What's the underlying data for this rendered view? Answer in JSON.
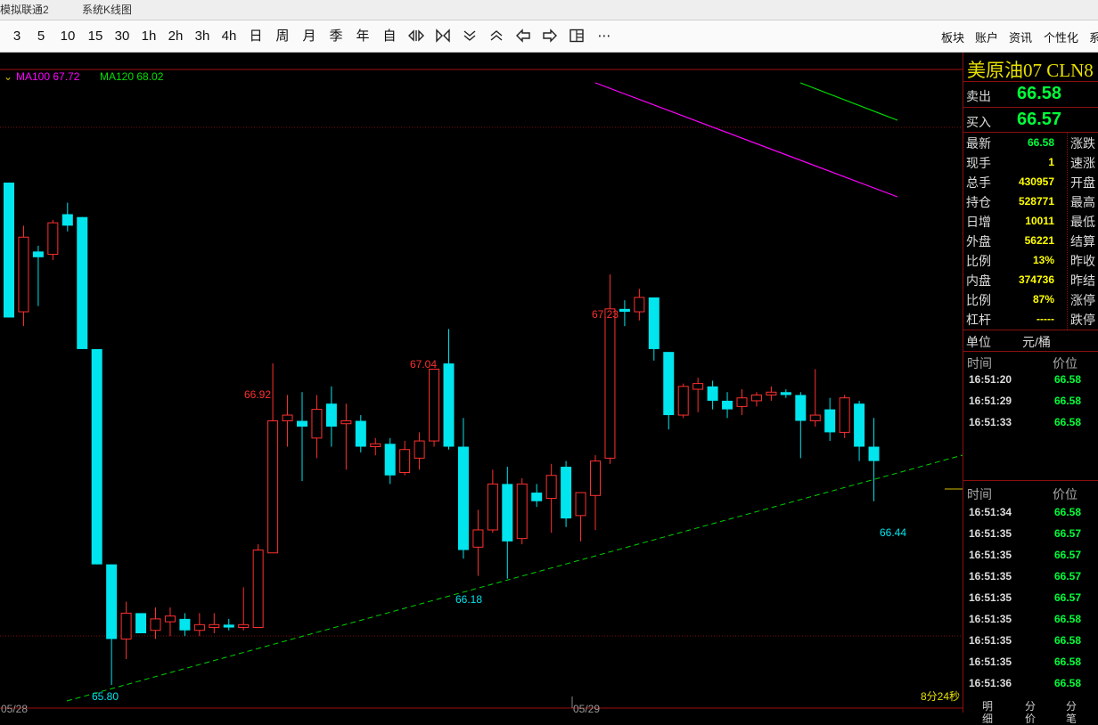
{
  "tabs": [
    "模拟联通2",
    "系统K线图"
  ],
  "toolbar": {
    "periods": [
      "3",
      "5",
      "10",
      "15",
      "30",
      "1h",
      "2h",
      "3h",
      "4h",
      "日",
      "周",
      "月",
      "季",
      "年",
      "自"
    ],
    "icons": [
      "split-view-icon",
      "fit-icon",
      "scroll-down-icon",
      "scroll-up-icon",
      "back-icon",
      "forward-icon",
      "layout-icon",
      "more-icon"
    ],
    "more_label": "⋯",
    "right_menu": [
      "板块",
      "账户",
      "资讯",
      "个性化",
      "系"
    ]
  },
  "chart": {
    "ma_indicator": "",
    "ma100": {
      "label": "MA100",
      "value": "67.72",
      "color": "#ff00ff"
    },
    "ma120": {
      "label": "MA120",
      "value": "68.02",
      "color": "#00e000"
    },
    "price_labels": [
      "67.23",
      "67.04",
      "66.92",
      "66.18",
      "65.80",
      "66.44"
    ],
    "date_labels": [
      "05/28",
      "05/29"
    ],
    "countdown": "8分24秒"
  },
  "chart_data": {
    "type": "candlestick",
    "title": "",
    "colors": {
      "up": "#ff3030",
      "down": "#00e5ee",
      "flat": "#ffffff",
      "trend": "#00d000"
    },
    "highs_lows_labeled": {
      "max": 67.23,
      "max2": 67.04,
      "max3": 66.92,
      "min": 65.8,
      "min2": 66.18,
      "last_low": 66.44
    },
    "candles": [
      {
        "o": 67.55,
        "h": 67.55,
        "l": 67.08,
        "c": 67.08
      },
      {
        "o": 67.1,
        "h": 67.4,
        "l": 67.05,
        "c": 67.36
      },
      {
        "o": 67.31,
        "h": 67.33,
        "l": 67.12,
        "c": 67.29
      },
      {
        "o": 67.3,
        "h": 67.42,
        "l": 67.28,
        "c": 67.41
      },
      {
        "o": 67.44,
        "h": 67.48,
        "l": 67.38,
        "c": 67.4
      },
      {
        "o": 67.43,
        "h": 67.43,
        "l": 66.97,
        "c": 66.97
      },
      {
        "o": 66.97,
        "h": 66.97,
        "l": 66.22,
        "c": 66.22
      },
      {
        "o": 66.22,
        "h": 66.22,
        "l": 65.8,
        "c": 65.96
      },
      {
        "o": 65.96,
        "h": 66.09,
        "l": 65.89,
        "c": 66.05
      },
      {
        "o": 66.05,
        "h": 66.05,
        "l": 65.98,
        "c": 65.98
      },
      {
        "o": 65.99,
        "h": 66.07,
        "l": 65.96,
        "c": 66.03
      },
      {
        "o": 66.02,
        "h": 66.07,
        "l": 65.97,
        "c": 66.04
      },
      {
        "o": 66.03,
        "h": 66.05,
        "l": 65.97,
        "c": 65.99
      },
      {
        "o": 65.99,
        "h": 66.05,
        "l": 65.97,
        "c": 66.01
      },
      {
        "o": 66.0,
        "h": 66.05,
        "l": 65.98,
        "c": 66.01
      },
      {
        "o": 66.01,
        "h": 66.03,
        "l": 65.99,
        "c": 66.0
      },
      {
        "o": 66.0,
        "h": 66.14,
        "l": 65.99,
        "c": 66.01
      },
      {
        "o": 66.0,
        "h": 66.29,
        "l": 66.0,
        "c": 66.27
      },
      {
        "o": 66.26,
        "h": 66.92,
        "l": 66.26,
        "c": 66.72
      },
      {
        "o": 66.72,
        "h": 66.81,
        "l": 66.63,
        "c": 66.74
      },
      {
        "o": 66.72,
        "h": 66.82,
        "l": 66.51,
        "c": 66.7
      },
      {
        "o": 66.66,
        "h": 66.81,
        "l": 66.59,
        "c": 66.76
      },
      {
        "o": 66.78,
        "h": 66.84,
        "l": 66.63,
        "c": 66.7
      },
      {
        "o": 66.71,
        "h": 66.78,
        "l": 66.55,
        "c": 66.72
      },
      {
        "o": 66.72,
        "h": 66.74,
        "l": 66.61,
        "c": 66.63
      },
      {
        "o": 66.63,
        "h": 66.66,
        "l": 66.6,
        "c": 66.64
      },
      {
        "o": 66.64,
        "h": 66.66,
        "l": 66.5,
        "c": 66.53
      },
      {
        "o": 66.54,
        "h": 66.65,
        "l": 66.53,
        "c": 66.62
      },
      {
        "o": 66.59,
        "h": 66.68,
        "l": 66.55,
        "c": 66.65
      },
      {
        "o": 66.65,
        "h": 66.81,
        "l": 66.63,
        "c": 66.9
      },
      {
        "o": 66.92,
        "h": 67.04,
        "l": 66.62,
        "c": 66.63
      },
      {
        "o": 66.63,
        "h": 66.73,
        "l": 66.24,
        "c": 66.27
      },
      {
        "o": 66.28,
        "h": 66.41,
        "l": 66.18,
        "c": 66.34
      },
      {
        "o": 66.34,
        "h": 66.55,
        "l": 66.33,
        "c": 66.5
      },
      {
        "o": 66.5,
        "h": 66.56,
        "l": 66.17,
        "c": 66.3
      },
      {
        "o": 66.31,
        "h": 66.52,
        "l": 66.29,
        "c": 66.5
      },
      {
        "o": 66.47,
        "h": 66.5,
        "l": 66.42,
        "c": 66.44
      },
      {
        "o": 66.45,
        "h": 66.57,
        "l": 66.33,
        "c": 66.53
      },
      {
        "o": 66.56,
        "h": 66.58,
        "l": 66.35,
        "c": 66.38
      },
      {
        "o": 66.39,
        "h": 66.47,
        "l": 66.3,
        "c": 66.47
      },
      {
        "o": 66.46,
        "h": 66.6,
        "l": 66.34,
        "c": 66.58
      },
      {
        "o": 66.59,
        "h": 67.23,
        "l": 66.57,
        "c": 67.11
      },
      {
        "o": 67.11,
        "h": 67.14,
        "l": 67.05,
        "c": 67.1
      },
      {
        "o": 67.1,
        "h": 67.18,
        "l": 67.07,
        "c": 67.15
      },
      {
        "o": 67.15,
        "h": 67.13,
        "l": 66.93,
        "c": 66.97
      },
      {
        "o": 66.96,
        "h": 66.96,
        "l": 66.69,
        "c": 66.74
      },
      {
        "o": 66.74,
        "h": 66.85,
        "l": 66.73,
        "c": 66.84
      },
      {
        "o": 66.83,
        "h": 66.87,
        "l": 66.75,
        "c": 66.85
      },
      {
        "o": 66.84,
        "h": 66.86,
        "l": 66.76,
        "c": 66.79
      },
      {
        "o": 66.79,
        "h": 66.82,
        "l": 66.73,
        "c": 66.76
      },
      {
        "o": 66.77,
        "h": 66.83,
        "l": 66.74,
        "c": 66.8
      },
      {
        "o": 66.79,
        "h": 66.82,
        "l": 66.77,
        "c": 66.81
      },
      {
        "o": 66.81,
        "h": 66.84,
        "l": 66.79,
        "c": 66.82
      },
      {
        "o": 66.82,
        "h": 66.83,
        "l": 66.8,
        "c": 66.81
      },
      {
        "o": 66.81,
        "h": 66.82,
        "l": 66.59,
        "c": 66.72
      },
      {
        "o": 66.72,
        "h": 66.9,
        "l": 66.7,
        "c": 66.74
      },
      {
        "o": 66.76,
        "h": 66.8,
        "l": 66.65,
        "c": 66.68
      },
      {
        "o": 66.68,
        "h": 66.81,
        "l": 66.66,
        "c": 66.8
      },
      {
        "o": 66.78,
        "h": 66.79,
        "l": 66.58,
        "c": 66.63
      },
      {
        "o": 66.63,
        "h": 66.73,
        "l": 66.44,
        "c": 66.58
      }
    ],
    "ma100": {
      "name": "MA100",
      "points": [
        {
          "i": 41,
          "v": 67.91
        },
        {
          "i": 62,
          "v": 67.21
        }
      ]
    },
    "ma120": {
      "name": "MA120",
      "points": [
        {
          "i": 55,
          "v": 67.91
        },
        {
          "i": 62,
          "v": 67.72
        }
      ]
    },
    "trendline": {
      "from": {
        "i": 3,
        "v": 65.8
      },
      "to": {
        "i": 67,
        "v": 66.69
      }
    },
    "grid": false
  },
  "quote": {
    "title": "美原油07  CLN8",
    "ask_label": "卖出",
    "ask": "66.58",
    "bid_label": "买入",
    "bid": "66.57",
    "rows": [
      {
        "label": "最新",
        "value": "66.58",
        "color": "#00ff3a",
        "right": "涨跌"
      },
      {
        "label": "现手",
        "value": "1",
        "color": "#ffff00",
        "right": "速涨"
      },
      {
        "label": "总手",
        "value": "430957",
        "color": "#ffff00",
        "right": "开盘"
      },
      {
        "label": "持仓",
        "value": "528771",
        "color": "#ffff00",
        "right": "最高"
      },
      {
        "label": "日增",
        "value": "10011",
        "color": "#ffff00",
        "right": "最低"
      },
      {
        "label": "外盘",
        "value": "56221",
        "color": "#ffff00",
        "right": "结算"
      },
      {
        "label": "比例",
        "value": "13%",
        "color": "#ffff00",
        "right": "昨收"
      },
      {
        "label": "内盘",
        "value": "374736",
        "color": "#ffff00",
        "right": "昨结"
      },
      {
        "label": "比例",
        "value": "87%",
        "color": "#ffff00",
        "right": "涨停"
      },
      {
        "label": "杠杆",
        "value": "-----",
        "color": "#ffff00",
        "right": "跌停"
      }
    ],
    "unit_label": "单位",
    "unit": "元/桶",
    "time_header": "时间",
    "price_header": "价位",
    "ticks1": [
      {
        "time": "16:51:20",
        "price": "66.58"
      },
      {
        "time": "16:51:29",
        "price": "66.58"
      },
      {
        "time": "16:51:33",
        "price": "66.58"
      }
    ],
    "ticks2": [
      {
        "time": "16:51:34",
        "price": "66.58"
      },
      {
        "time": "16:51:35",
        "price": "66.57"
      },
      {
        "time": "16:51:35",
        "price": "66.57"
      },
      {
        "time": "16:51:35",
        "price": "66.57"
      },
      {
        "time": "16:51:35",
        "price": "66.57"
      },
      {
        "time": "16:51:35",
        "price": "66.58"
      },
      {
        "time": "16:51:35",
        "price": "66.58"
      },
      {
        "time": "16:51:35",
        "price": "66.58"
      },
      {
        "time": "16:51:36",
        "price": "66.58"
      }
    ],
    "bottom_tabs": [
      "明细",
      "分价",
      "分笔"
    ]
  }
}
